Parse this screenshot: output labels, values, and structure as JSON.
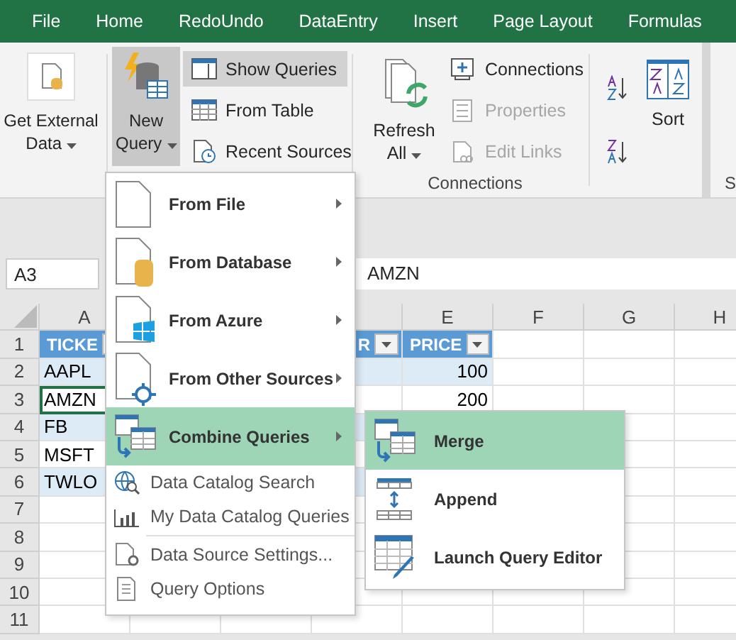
{
  "ribbon_tabs": [
    {
      "label": "File"
    },
    {
      "label": "Home"
    },
    {
      "label": "RedoUndo"
    },
    {
      "label": "DataEntry"
    },
    {
      "label": "Insert"
    },
    {
      "label": "Page Layout"
    },
    {
      "label": "Formulas"
    }
  ],
  "ribbon": {
    "get_external_data": {
      "label": "Get External Data"
    },
    "new_query": {
      "label": "New Query",
      "pressed": true
    },
    "query_buttons": [
      {
        "label": "Show Queries",
        "pressed": true
      },
      {
        "label": "From Table",
        "pressed": false
      },
      {
        "label": "Recent Sources",
        "pressed": false
      }
    ],
    "refresh_all": {
      "label": "Refresh All"
    },
    "connection_buttons": [
      {
        "label": "Connections",
        "disabled": false
      },
      {
        "label": "Properties",
        "disabled": true
      },
      {
        "label": "Edit Links",
        "disabled": true
      }
    ],
    "group_label": "Connections",
    "sort": {
      "label": "Sort"
    },
    "cut_group_label": "S"
  },
  "formula_bar": {
    "name_box": "A3",
    "value": "AMZN"
  },
  "sheet": {
    "columns": [
      {
        "label": "A"
      },
      {
        "label": "E"
      },
      {
        "label": "F"
      },
      {
        "label": "G"
      },
      {
        "label": "H"
      }
    ],
    "rows": [
      {
        "number": "1",
        "kind": "header",
        "cells": [
          {
            "text": "TICKE"
          },
          null,
          null,
          {
            "text": "R"
          },
          {
            "text": "PRICE"
          }
        ]
      },
      {
        "number": "2",
        "band": true,
        "cells": [
          {
            "text": "AAPL",
            "selected": false
          },
          null,
          null,
          null,
          {
            "text": "100",
            "selected": false
          }
        ]
      },
      {
        "number": "3",
        "band": false,
        "cells": [
          {
            "text": "AMZN",
            "selected": true
          },
          null,
          null,
          null,
          {
            "text": "200",
            "selected": false
          }
        ]
      },
      {
        "number": "4",
        "band": true,
        "cells": [
          {
            "text": "FB",
            "selected": false
          },
          null,
          null,
          null,
          null
        ]
      },
      {
        "number": "5",
        "band": false,
        "cells": [
          {
            "text": "MSFT",
            "selected": false
          },
          null,
          null,
          null,
          null
        ]
      },
      {
        "number": "6",
        "band": true,
        "cells": [
          {
            "text": "TWLO",
            "selected": false
          },
          null,
          null,
          null,
          null
        ]
      },
      {
        "number": "7"
      },
      {
        "number": "8"
      },
      {
        "number": "9"
      },
      {
        "number": "10"
      },
      {
        "number": "11"
      }
    ]
  },
  "menu": {
    "items": [
      {
        "kind": "large",
        "label": "From File",
        "submenu": true,
        "highlighted": false
      },
      {
        "kind": "large",
        "label": "From Database",
        "submenu": true,
        "highlighted": false
      },
      {
        "kind": "large",
        "label": "From Azure",
        "submenu": true,
        "highlighted": false
      },
      {
        "kind": "large",
        "label": "From Other Sources",
        "submenu": true,
        "highlighted": false
      },
      {
        "kind": "large",
        "label": "Combine Queries",
        "submenu": true,
        "highlighted": true
      },
      {
        "kind": "small",
        "label": "Data Catalog Search"
      },
      {
        "kind": "small",
        "label": "My Data Catalog Queries"
      },
      {
        "kind": "separator"
      },
      {
        "kind": "small",
        "label": "Data Source Settings..."
      },
      {
        "kind": "small",
        "label": "Query Options"
      }
    ]
  },
  "submenu": {
    "items": [
      {
        "label": "Merge",
        "highlighted": true
      },
      {
        "label": "Append",
        "highlighted": false
      },
      {
        "label": "Launch Query Editor",
        "highlighted": false
      }
    ]
  }
}
